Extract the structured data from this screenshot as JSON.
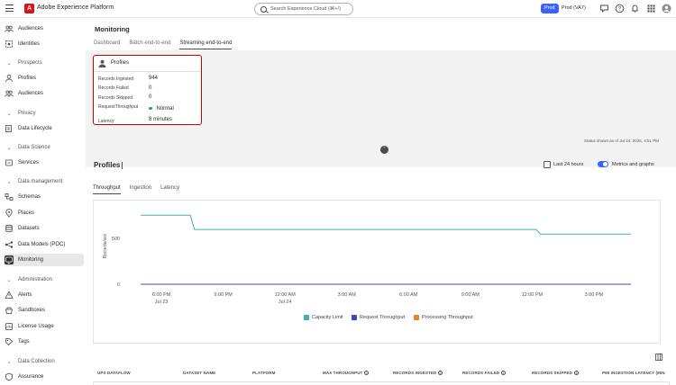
{
  "topbar": {
    "app_title": "Adobe Experience Platform",
    "logo_letter": "A",
    "search_placeholder": "Search Experience Cloud (⌘+/)",
    "org_badge": "Prod",
    "org_name": "Prod (VA7)",
    "icons": [
      "menu-icon",
      "feedback-icon",
      "help-icon",
      "bell-icon",
      "apps-grid-icon",
      "user-avatar-icon"
    ]
  },
  "sidebar": {
    "items": [
      {
        "label": "Audiences",
        "icon": "audiences-icon"
      },
      {
        "label": "Identities",
        "icon": "identities-icon"
      },
      {
        "section": "Prospects"
      },
      {
        "label": "Profiles",
        "icon": "profile-icon"
      },
      {
        "label": "Audiences",
        "icon": "audiences-icon"
      },
      {
        "section": "Privacy"
      },
      {
        "label": "Data Lifecycle",
        "icon": "data-lifecycle-icon"
      },
      {
        "section": "Data Science"
      },
      {
        "label": "Services",
        "icon": "services-icon"
      },
      {
        "section": "Data management"
      },
      {
        "label": "Schemas",
        "icon": "schemas-icon"
      },
      {
        "label": "Places",
        "icon": "places-icon"
      },
      {
        "label": "Datasets",
        "icon": "datasets-icon"
      },
      {
        "label": "Data Models (POC)",
        "icon": "data-models-icon"
      },
      {
        "label": "Monitoring",
        "icon": "monitoring-icon",
        "active": true
      },
      {
        "section": "Administration"
      },
      {
        "label": "Alerts",
        "icon": "alerts-icon"
      },
      {
        "label": "Sandboxes",
        "icon": "sandboxes-icon"
      },
      {
        "label": "License Usage",
        "icon": "license-icon"
      },
      {
        "label": "Tags",
        "icon": "tags-icon"
      },
      {
        "section": "Data Collection"
      },
      {
        "label": "Assurance",
        "icon": "assurance-icon"
      }
    ]
  },
  "main": {
    "title": "Monitoring",
    "tabs": [
      {
        "label": "Dashboard",
        "active": false
      },
      {
        "label": "Batch end-to-end",
        "active": false
      },
      {
        "label": "Streaming end-to-end",
        "active": true
      }
    ],
    "profiles_card": {
      "title": "Profiles",
      "rows": [
        {
          "key": "Records Ingested",
          "value": "944"
        },
        {
          "key": "Records Failed",
          "value": "0"
        },
        {
          "key": "Records Skipped",
          "value": "0"
        },
        {
          "key": "RequestThroughput",
          "value": "Normal",
          "status_color": "#2d9d78"
        },
        {
          "key": "Latency",
          "value": "8 minutes"
        }
      ]
    },
    "status_note": "Status shown as of Jul 24, 2025, 4:51 PM",
    "section": {
      "title": "Profiles",
      "range_label": "Last 24 hours",
      "toggle_label": "Metrics and graphs",
      "toggle_on": true
    },
    "chart_tabs": [
      {
        "label": "Throughput",
        "active": true
      },
      {
        "label": "Ingestion",
        "active": false
      },
      {
        "label": "Latency",
        "active": false
      }
    ],
    "table_headers": [
      {
        "label": "UPS DATAFLOW",
        "info": false
      },
      {
        "label": "DATASET NAME",
        "info": false
      },
      {
        "label": "PLATFORM",
        "info": false
      },
      {
        "label": "MAX THROUGHPUT",
        "info": true
      },
      {
        "label": "RECORDS INGESTED",
        "info": true
      },
      {
        "label": "RECORDS FAILED",
        "info": true
      },
      {
        "label": "RECORDS SKIPPED",
        "info": true
      },
      {
        "label": "P95 INGESTION LATENCY (MIN",
        "info": false
      }
    ]
  },
  "chart_data": {
    "type": "line",
    "title": "",
    "xlabel": "",
    "ylabel": "Records/sec",
    "ylim": [
      0,
      830
    ],
    "yticks": [
      0,
      500
    ],
    "xticks": [
      {
        "t": 18,
        "label": "6:00 PM",
        "sub": "Jul 23"
      },
      {
        "t": 21,
        "label": "9:00 PM",
        "sub": ""
      },
      {
        "t": 24,
        "label": "12:00 AM",
        "sub": "Jul 24"
      },
      {
        "t": 27,
        "label": "3:00 AM",
        "sub": ""
      },
      {
        "t": 30,
        "label": "6:00 AM",
        "sub": ""
      },
      {
        "t": 33,
        "label": "9:00 AM",
        "sub": ""
      },
      {
        "t": 36,
        "label": "12:00 PM",
        "sub": ""
      },
      {
        "t": 39,
        "label": "3:00 PM",
        "sub": ""
      }
    ],
    "xlim": [
      16.2,
      41.5
    ],
    "series": [
      {
        "name": "Capacity Limit",
        "color": "#3fb3a8",
        "points": [
          [
            17.0,
            750
          ],
          [
            19.4,
            750
          ],
          [
            19.6,
            595
          ],
          [
            36.2,
            595
          ],
          [
            36.4,
            545
          ],
          [
            40.8,
            545
          ]
        ]
      },
      {
        "name": "Request Throughput",
        "color": "#3b4bbf",
        "points": [
          [
            17.0,
            0
          ],
          [
            40.8,
            0
          ]
        ]
      },
      {
        "name": "Processing Throughput",
        "color": "#e8842c",
        "points": [
          [
            17.0,
            0
          ],
          [
            40.8,
            0
          ]
        ]
      }
    ],
    "legend_position": "bottom",
    "grid": false
  }
}
